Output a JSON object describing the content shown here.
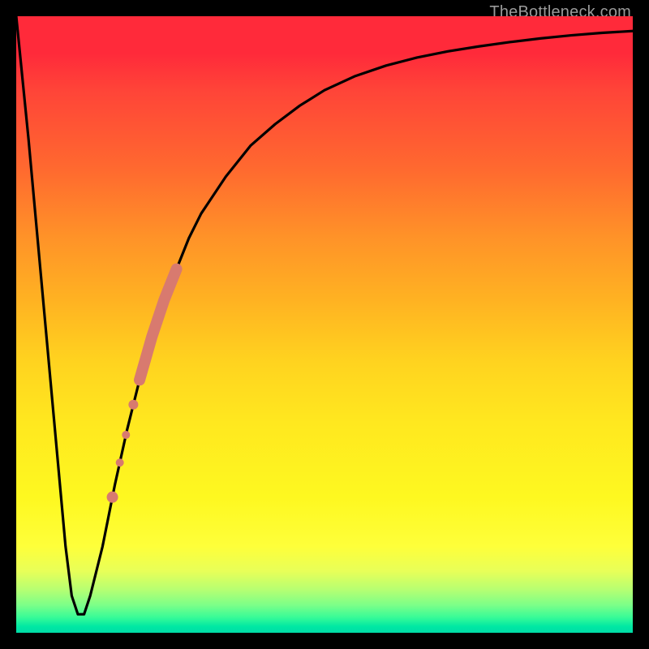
{
  "attribution": "TheBottleneck.com",
  "colors": {
    "background": "#000000",
    "gradient_top": "#ff2a3a",
    "gradient_bottom": "#00dca7",
    "curve": "#000000",
    "highlight": "#d87a6f"
  },
  "chart_data": {
    "type": "line",
    "title": "",
    "xlabel": "",
    "ylabel": "",
    "xlim": [
      0,
      100
    ],
    "ylim": [
      0,
      100
    ],
    "grid": false,
    "legend": false,
    "series": [
      {
        "name": "curve",
        "x": [
          0,
          2,
          4,
          6,
          8,
          9,
          10,
          11,
          12,
          14,
          16,
          18,
          20,
          22,
          24,
          26,
          28,
          30,
          34,
          38,
          42,
          46,
          50,
          55,
          60,
          65,
          70,
          75,
          80,
          85,
          90,
          95,
          100
        ],
        "y": [
          100,
          80,
          58,
          36,
          14,
          6,
          3,
          3,
          6,
          14,
          24,
          33,
          41,
          48,
          54,
          59,
          64,
          68,
          74,
          79,
          82.5,
          85.5,
          88,
          90.3,
          92,
          93.3,
          94.3,
          95.1,
          95.8,
          96.4,
          96.9,
          97.3,
          97.6
        ]
      }
    ],
    "highlights": [
      {
        "type": "thick_segment",
        "x_start": 20,
        "x_end": 26,
        "stroke_width": 14
      },
      {
        "type": "dot",
        "x": 19.0,
        "r": 6
      },
      {
        "type": "dot",
        "x": 17.8,
        "r": 5
      },
      {
        "type": "dot",
        "x": 16.8,
        "r": 5
      },
      {
        "type": "dot",
        "x": 15.6,
        "r": 7
      }
    ]
  }
}
